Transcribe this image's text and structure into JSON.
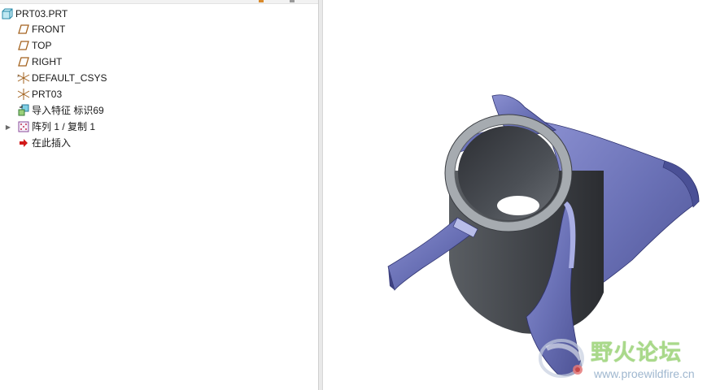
{
  "model_tree": {
    "items": [
      {
        "label": "PRT03.PRT",
        "icon": "part-icon"
      },
      {
        "label": "FRONT",
        "icon": "datum-plane-icon"
      },
      {
        "label": "TOP",
        "icon": "datum-plane-icon"
      },
      {
        "label": "RIGHT",
        "icon": "datum-plane-icon"
      },
      {
        "label": "DEFAULT_CSYS",
        "icon": "coordinate-system-icon"
      },
      {
        "label": "PRT03",
        "icon": "coordinate-system-icon"
      },
      {
        "label": "导入特征 标识69",
        "icon": "import-feature-icon"
      },
      {
        "label": "阵列 1 / 复制 1",
        "icon": "pattern-icon",
        "expandable": true
      },
      {
        "label": "在此插入",
        "icon": "insert-here-arrow-icon"
      }
    ]
  },
  "watermark": {
    "title": "野火论坛",
    "url": "www.proewildfire.cn"
  },
  "colors": {
    "blade": "#6d74b8",
    "hub": "#3e4146",
    "ring": "#a6abb0",
    "insert_arrow": "#d21a1a",
    "watermark_text": "#a9d98a"
  }
}
